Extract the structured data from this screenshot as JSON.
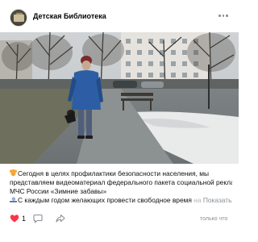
{
  "header": {
    "group_name": "Детская Библиотека",
    "avatar_icon": "library-avatar",
    "more_icon": "more-horizontal-icon"
  },
  "media": {
    "kind": "photo",
    "alt_icon": "photo-preview"
  },
  "post": {
    "line1": "Сегодня в целях профилактики безопасности населения, мы",
    "line2": "представляем видеоматериал федерального пакета социальной рекламы",
    "line3": "МЧС России «Зимние забавы»",
    "line4_main": "С каждым годом желающих провести свободное время",
    "line4_fade": "на",
    "show_all": "Показать ещё"
  },
  "actions": {
    "like_count": "1",
    "time_label": "только что",
    "liked": true
  },
  "colors": {
    "accent_red": "#ff3347",
    "muted": "#8a8f95",
    "text": "#111111"
  }
}
